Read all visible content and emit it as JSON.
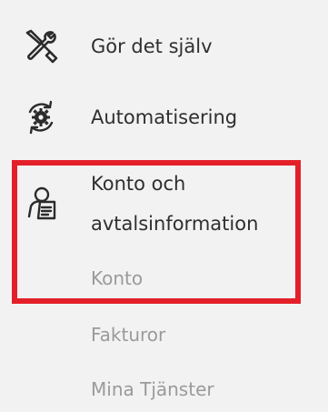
{
  "nav": {
    "items": [
      {
        "label": "Gör det själv",
        "icon": "tools-icon"
      },
      {
        "label": "Automatisering",
        "icon": "automation-gear-icon"
      },
      {
        "label": "Konto och\navtalsinformation",
        "icon": "account-contract-icon"
      }
    ],
    "subitems": [
      {
        "label": "Konto"
      },
      {
        "label": "Fakturor"
      },
      {
        "label": "Mina Tjänster"
      }
    ]
  },
  "colors": {
    "background": "#f2f2f2",
    "text_primary": "#2f2f2f",
    "text_muted": "#9a9a9a",
    "highlight": "#e3202a"
  }
}
